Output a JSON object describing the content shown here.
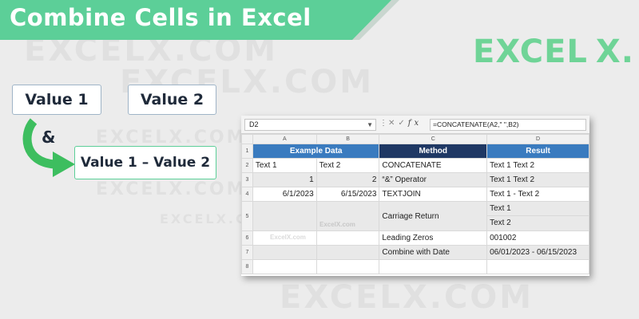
{
  "banner": {
    "title": "Combine Cells in Excel"
  },
  "logo": {
    "text": "EXCEL",
    "x": "X."
  },
  "watermarks": [
    "EXCELX.COM",
    "EXCELX.COM",
    "EXCELX.COM",
    "EXCELX.COM",
    "EXCELX.COM",
    "EXCELX.COM",
    "ExcelX.com",
    "ExcelX.com"
  ],
  "diagram": {
    "value1": "Value 1",
    "value2": "Value 2",
    "operator": "&",
    "result": "Value 1 – Value 2"
  },
  "sheet": {
    "namebox": "D2",
    "formula": "=CONCATENATE(A2,\" \",B2)",
    "columns": [
      "A",
      "B",
      "C",
      "D"
    ],
    "headers": {
      "example": "Example Data",
      "method": "Method",
      "result": "Result"
    },
    "rows": [
      {
        "n": "2",
        "a": "Text 1",
        "b": "Text 2",
        "c": "CONCATENATE",
        "d": "Text 1 Text 2"
      },
      {
        "n": "3",
        "a": "1",
        "b": "2",
        "c": "“&” Operator",
        "d": "Text 1 Text 2"
      },
      {
        "n": "4",
        "a": "6/1/2023",
        "b": "6/15/2023",
        "c": "TEXTJOIN",
        "d": "Text 1 - Text 2"
      },
      {
        "n": "5",
        "a": "",
        "b": "",
        "c": "Carriage Return",
        "d": "Text 1",
        "d2": "Text 2"
      },
      {
        "n": "6",
        "a": "",
        "b": "",
        "c": "Leading Zeros",
        "d": "001002"
      },
      {
        "n": "7",
        "a": "",
        "b": "",
        "c": "Combine with Date",
        "d": "06/01/2023 - 06/15/2023"
      },
      {
        "n": "8",
        "a": "",
        "b": "",
        "c": "",
        "d": ""
      }
    ],
    "row_numbers": [
      "1"
    ]
  },
  "colors": {
    "banner": "#5ccf98",
    "header_blue": "#3a7bbf",
    "header_navy": "#1f3864",
    "logo": "#6fd497",
    "arrow": "#3dbe5f"
  }
}
